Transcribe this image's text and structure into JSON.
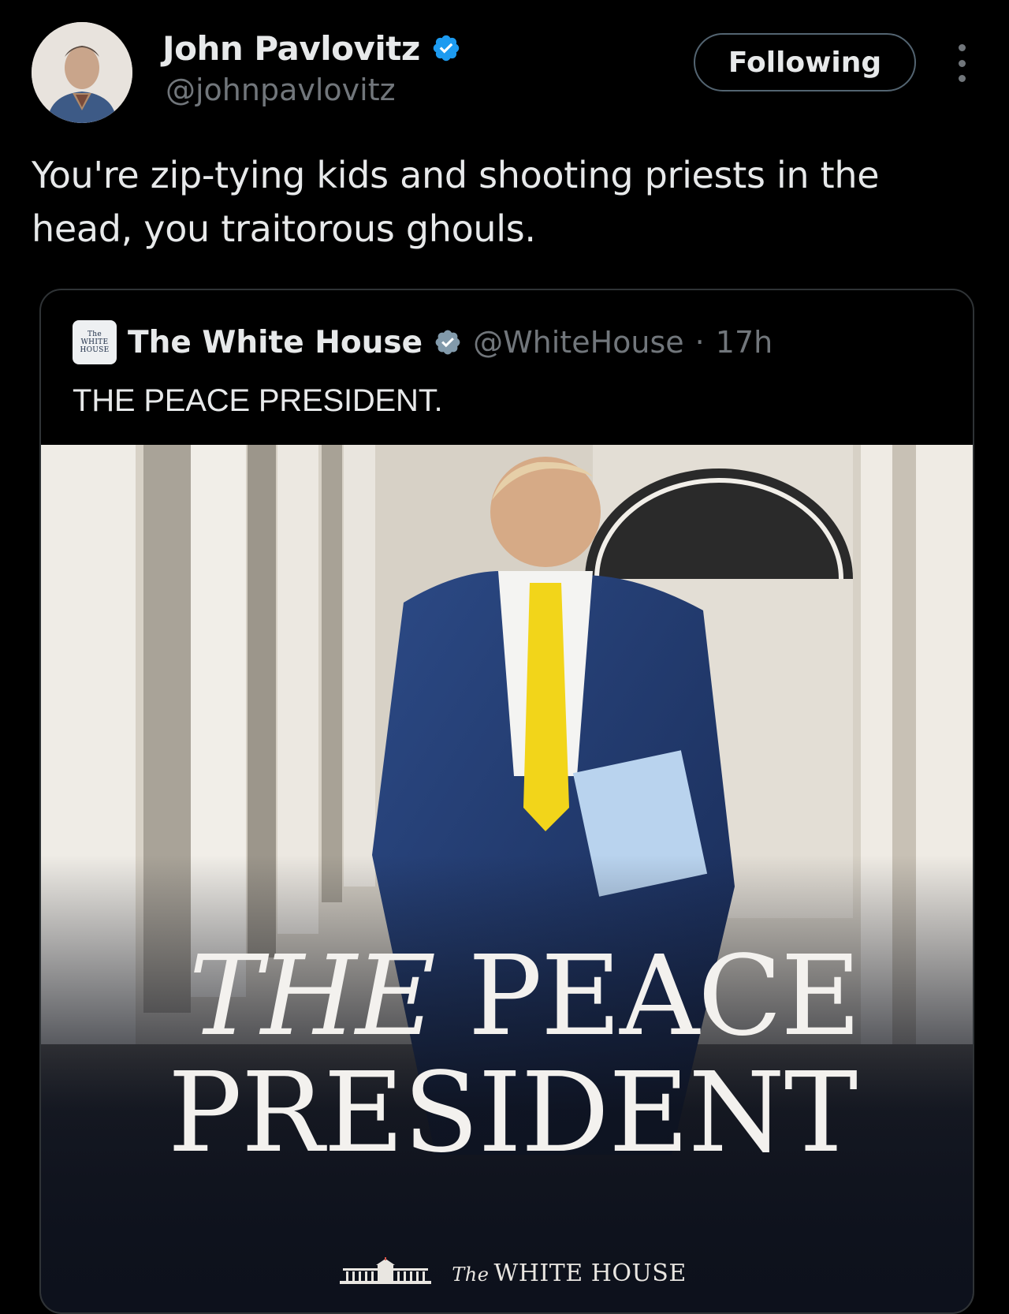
{
  "author": {
    "name": "John Pavlovitz",
    "handle": "@johnpavlovitz",
    "verified": true,
    "follow_label": "Following"
  },
  "tweet": {
    "text": "You're zip-tying kids and shooting priests in the head, you traitorous ghouls."
  },
  "quoted_tweet": {
    "name": "The White House",
    "handle": "@WhiteHouse",
    "separator": "·",
    "time": "17h",
    "text": "THE PEACE PRESIDENT.",
    "verified": true,
    "logo_lines": [
      "The",
      "WHITE",
      "HOUSE"
    ]
  },
  "poster": {
    "line1_a": "THE",
    "line1_b": "PEACE",
    "line2": "PRESIDENT",
    "footer_the": "The",
    "footer_text": "WHITE HOUSE"
  },
  "icons": {
    "verified": "verified-badge-icon",
    "more": "more-vertical-icon"
  },
  "colors": {
    "background": "#000000",
    "text_primary": "#e7e9ea",
    "text_secondary": "#71767b",
    "verified_blue": "#1d9bf0",
    "verified_gray": "#829aab",
    "border": "#2f3336"
  }
}
